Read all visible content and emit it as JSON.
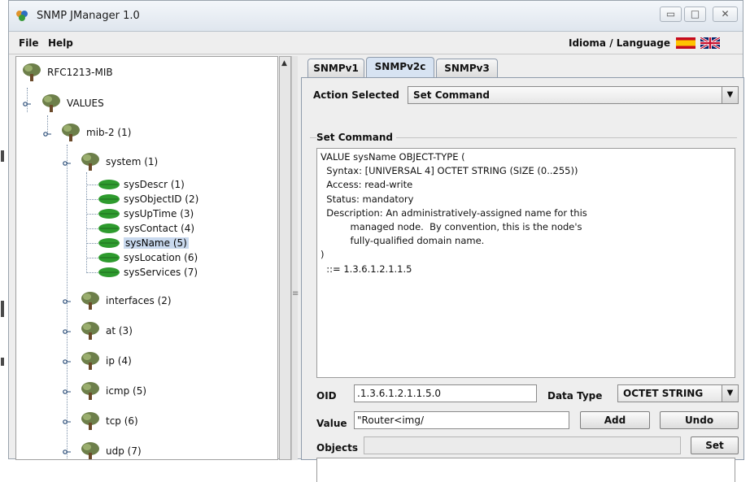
{
  "window": {
    "title": "SNMP JManager 1.0"
  },
  "menubar": {
    "file": "File",
    "help": "Help",
    "language": "Idioma / Language"
  },
  "tree": {
    "root": "RFC1213-MIB",
    "values": "VALUES",
    "mib2": "mib-2 (1)",
    "system": "system (1)",
    "leaves": [
      {
        "label": "sysDescr (1)",
        "selected": false
      },
      {
        "label": "sysObjectID (2)",
        "selected": false
      },
      {
        "label": "sysUpTime (3)",
        "selected": false
      },
      {
        "label": "sysContact (4)",
        "selected": false
      },
      {
        "label": "sysName (5)",
        "selected": true
      },
      {
        "label": "sysLocation (6)",
        "selected": false
      },
      {
        "label": "sysServices (7)",
        "selected": false
      }
    ],
    "groups": [
      "interfaces (2)",
      "at (3)",
      "ip (4)",
      "icmp (5)",
      "tcp (6)",
      "udp (7)"
    ]
  },
  "tabs": [
    {
      "label": "SNMPv1",
      "active": false
    },
    {
      "label": "SNMPv2c",
      "active": true
    },
    {
      "label": "SNMPv3",
      "active": false
    }
  ],
  "form": {
    "action_label": "Action Selected",
    "action_value": "Set Command",
    "group_title": "Set Command",
    "description": "VALUE sysName OBJECT-TYPE (\n  Syntax: [UNIVERSAL 4] OCTET STRING (SIZE (0..255))\n  Access: read-write\n  Status: mandatory\n  Description: An administratively-assigned name for this\n          managed node.  By convention, this is the node's\n          fully-qualified domain name.\n)\n  ::= 1.3.6.1.2.1.1.5",
    "oid_label": "OID",
    "oid_value": ".1.3.6.1.2.1.1.5.0",
    "datatype_label": "Data Type",
    "datatype_value": "OCTET STRING",
    "value_label": "Value",
    "value_value": "\"Router<img/",
    "add_button": "Add",
    "undo_button": "Undo",
    "objects_label": "Objects",
    "objects_value": "",
    "set_button": "Set"
  },
  "colors": {
    "accent": "#d7e3f2",
    "selection": "#c9d9ee",
    "leaf_green": "#2e9b2e"
  }
}
